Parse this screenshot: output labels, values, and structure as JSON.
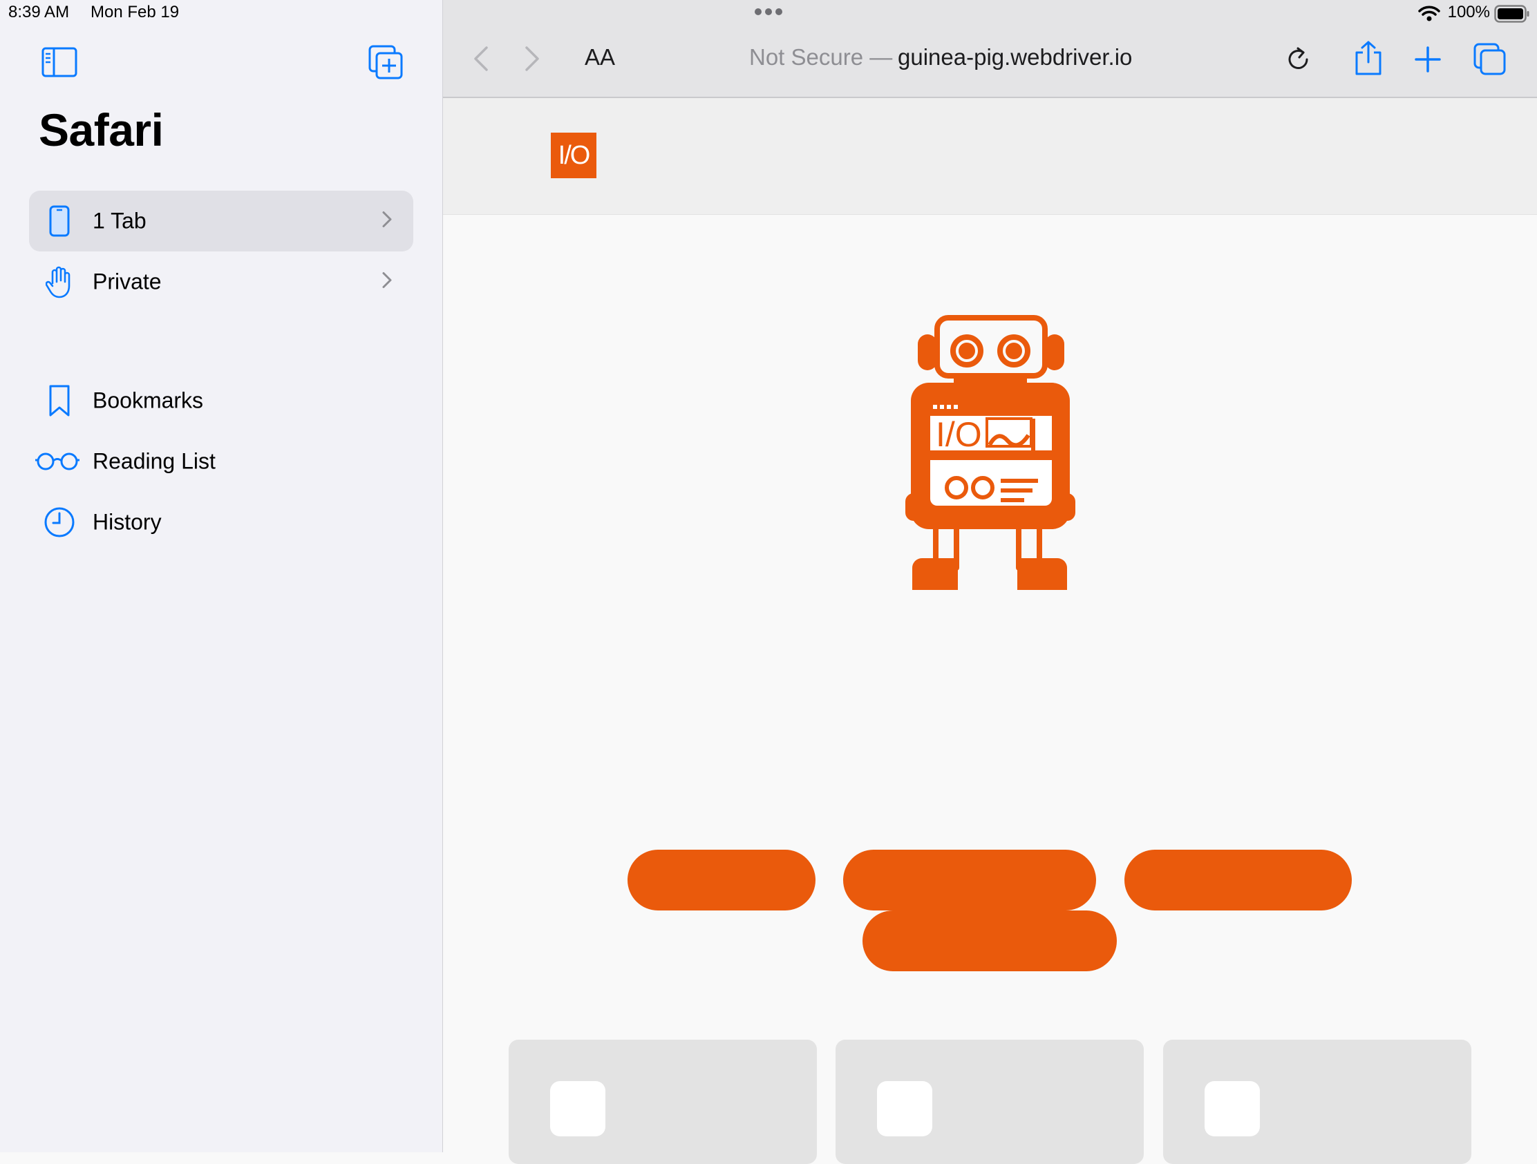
{
  "status_bar": {
    "time": "8:39 AM",
    "date": "Mon Feb 19",
    "battery_percent": "100%",
    "icons": [
      "wifi-icon",
      "battery-icon",
      "multitask-dots-icon"
    ]
  },
  "sidebar": {
    "title": "Safari",
    "top_icons": [
      "sidebar-toggle-icon",
      "new-tab-group-icon"
    ],
    "tab_groups": [
      {
        "label": "1 Tab",
        "icon": "phone-icon",
        "selected": true
      },
      {
        "label": "Private",
        "icon": "hand-icon",
        "selected": false
      }
    ],
    "links": [
      {
        "label": "Bookmarks",
        "icon": "bookmark-icon"
      },
      {
        "label": "Reading List",
        "icon": "glasses-icon"
      },
      {
        "label": "History",
        "icon": "clock-icon"
      }
    ]
  },
  "toolbar": {
    "reader_label": "AA",
    "url_prefix": "Not Secure —",
    "url_host": "guinea-pig.webdriver.io",
    "icons": [
      "back-icon",
      "forward-icon",
      "reload-icon",
      "share-icon",
      "new-tab-icon",
      "tabs-overview-icon"
    ]
  },
  "webpage": {
    "logo_text": "I/O",
    "robot_text": "I/O",
    "accent_color": "#ea5a0c",
    "pill_buttons": 4,
    "cards": 3
  }
}
